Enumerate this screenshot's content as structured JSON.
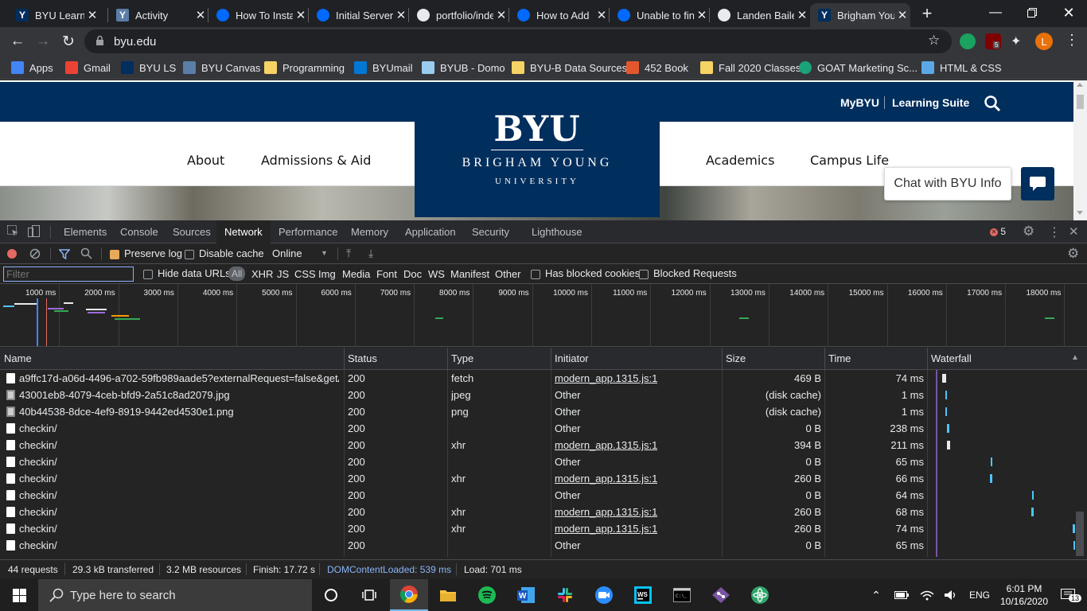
{
  "browser": {
    "tabs": [
      {
        "title": "BYU Learning Suite",
        "icon": "byu-learning-icon",
        "color": "#002e5d"
      },
      {
        "title": "Activity",
        "icon": "byu-activity-icon",
        "color": "#5b7ea8"
      },
      {
        "title": "How To Install",
        "icon": "digitalocean-icon",
        "color": "#0069ff"
      },
      {
        "title": "Initial Server Setup",
        "icon": "digitalocean-icon",
        "color": "#0069ff"
      },
      {
        "title": "portfolio/index",
        "icon": "github-icon",
        "color": "#ffffff"
      },
      {
        "title": "How to Add",
        "icon": "digitalocean-icon",
        "color": "#0069ff"
      },
      {
        "title": "Unable to find",
        "icon": "digitalocean-icon",
        "color": "#0069ff"
      },
      {
        "title": "Landen Bailey",
        "icon": "globe-icon",
        "color": "#e8eaed"
      },
      {
        "title": "Brigham Young",
        "icon": "byu-y-icon",
        "color": "#002e5d"
      }
    ],
    "url": "byu.edu",
    "profile_initial": "L",
    "ublock_badge": "5",
    "bookmarks": [
      {
        "label": "Apps",
        "icon": "apps-grid-icon",
        "color": "#4285f4"
      },
      {
        "label": "Gmail",
        "icon": "gmail-icon",
        "color": "#ea4335"
      },
      {
        "label": "BYU LS",
        "icon": "byu-icon",
        "color": "#002e5d"
      },
      {
        "label": "BYU Canvas",
        "icon": "canvas-icon",
        "color": "#5b7ea8"
      },
      {
        "label": "Programming",
        "icon": "folder-icon",
        "color": "#f6d365"
      },
      {
        "label": "BYUmail",
        "icon": "outlook-icon",
        "color": "#0078d4"
      },
      {
        "label": "BYUB - Domo",
        "icon": "domo-icon",
        "color": "#99ccee"
      },
      {
        "label": "BYU-B Data Sources",
        "icon": "folder-icon",
        "color": "#f6d365"
      },
      {
        "label": "452 Book",
        "icon": "mcgraw-icon",
        "color": "#e4572e"
      },
      {
        "label": "Fall 2020 Classes",
        "icon": "folder-icon",
        "color": "#f6d365"
      },
      {
        "label": "GOAT Marketing Sc...",
        "icon": "goat-icon",
        "color": "#1aa37a"
      },
      {
        "label": "HTML & CSS",
        "icon": "html-icon",
        "color": "#5aa9e6"
      }
    ]
  },
  "site": {
    "utility": {
      "mybyu": "MyBYU",
      "learning_suite": "Learning Suite"
    },
    "nav": [
      "About",
      "Admissions & Aid",
      "Academics",
      "Campus Life"
    ],
    "logo": {
      "big": "BYU",
      "line2": "BRIGHAM YOUNG",
      "line3": "UNIVERSITY"
    },
    "chat_label": "Chat with BYU Info",
    "brand_color": "#002e5d"
  },
  "devtools": {
    "tabs": [
      "Elements",
      "Console",
      "Sources",
      "Network",
      "Performance",
      "Memory",
      "Application",
      "Security",
      "Lighthouse"
    ],
    "active_tab": "Network",
    "error_count": "5",
    "toolbar": {
      "preserve_log": "Preserve log",
      "disable_cache": "Disable cache",
      "throttle": "Online"
    },
    "filter": {
      "placeholder": "Filter",
      "hide_data_urls": "Hide data URLs",
      "types": [
        "All",
        "XHR",
        "JS",
        "CSS",
        "Img",
        "Media",
        "Font",
        "Doc",
        "WS",
        "Manifest",
        "Other"
      ],
      "has_blocked_cookies": "Has blocked cookies",
      "blocked_requests": "Blocked Requests"
    },
    "overview_ticks": [
      "1000 ms",
      "2000 ms",
      "3000 ms",
      "4000 ms",
      "5000 ms",
      "6000 ms",
      "7000 ms",
      "8000 ms",
      "9000 ms",
      "10000 ms",
      "11000 ms",
      "12000 ms",
      "13000 ms",
      "14000 ms",
      "15000 ms",
      "16000 ms",
      "17000 ms",
      "18000 ms"
    ],
    "columns": [
      "Name",
      "Status",
      "Type",
      "Initiator",
      "Size",
      "Time",
      "Waterfall"
    ],
    "requests": [
      {
        "name": "a9ffc17d-a06d-4496-a702-59fb989aade5?externalRequest=false&getAvail...",
        "status": "200",
        "type": "fetch",
        "initiator": "modern_app.1315.js:1",
        "size": "469 B",
        "time": "74 ms",
        "icon": "doc"
      },
      {
        "name": "43001eb8-4079-4ceb-bfd9-2a51c8ad2079.jpg",
        "status": "200",
        "type": "jpeg",
        "initiator": "Other",
        "size": "(disk cache)",
        "time": "1 ms",
        "icon": "img"
      },
      {
        "name": "40b44538-8dce-4ef9-8919-9442ed4530e1.png",
        "status": "200",
        "type": "png",
        "initiator": "Other",
        "size": "(disk cache)",
        "time": "1 ms",
        "icon": "img"
      },
      {
        "name": "checkin/",
        "status": "200",
        "type": "",
        "initiator": "Other",
        "size": "0 B",
        "time": "238 ms",
        "icon": "doc"
      },
      {
        "name": "checkin/",
        "status": "200",
        "type": "xhr",
        "initiator": "modern_app.1315.js:1",
        "size": "394 B",
        "time": "211 ms",
        "icon": "doc"
      },
      {
        "name": "checkin/",
        "status": "200",
        "type": "",
        "initiator": "Other",
        "size": "0 B",
        "time": "65 ms",
        "icon": "doc"
      },
      {
        "name": "checkin/",
        "status": "200",
        "type": "xhr",
        "initiator": "modern_app.1315.js:1",
        "size": "260 B",
        "time": "66 ms",
        "icon": "doc"
      },
      {
        "name": "checkin/",
        "status": "200",
        "type": "",
        "initiator": "Other",
        "size": "0 B",
        "time": "64 ms",
        "icon": "doc"
      },
      {
        "name": "checkin/",
        "status": "200",
        "type": "xhr",
        "initiator": "modern_app.1315.js:1",
        "size": "260 B",
        "time": "68 ms",
        "icon": "doc"
      },
      {
        "name": "checkin/",
        "status": "200",
        "type": "xhr",
        "initiator": "modern_app.1315.js:1",
        "size": "260 B",
        "time": "74 ms",
        "icon": "doc"
      },
      {
        "name": "checkin/",
        "status": "200",
        "type": "",
        "initiator": "Other",
        "size": "0 B",
        "time": "65 ms",
        "icon": "doc"
      }
    ],
    "status": {
      "requests": "44 requests",
      "transferred": "29.3 kB transferred",
      "resources": "3.2 MB resources",
      "finish": "Finish: 17.72 s",
      "dcl": "DOMContentLoaded: 539 ms",
      "load": "Load: 701 ms"
    }
  },
  "taskbar": {
    "search_placeholder": "Type here to search",
    "language": "ENG",
    "time": "6:01 PM",
    "date": "10/16/2020",
    "notification_count": "13"
  }
}
